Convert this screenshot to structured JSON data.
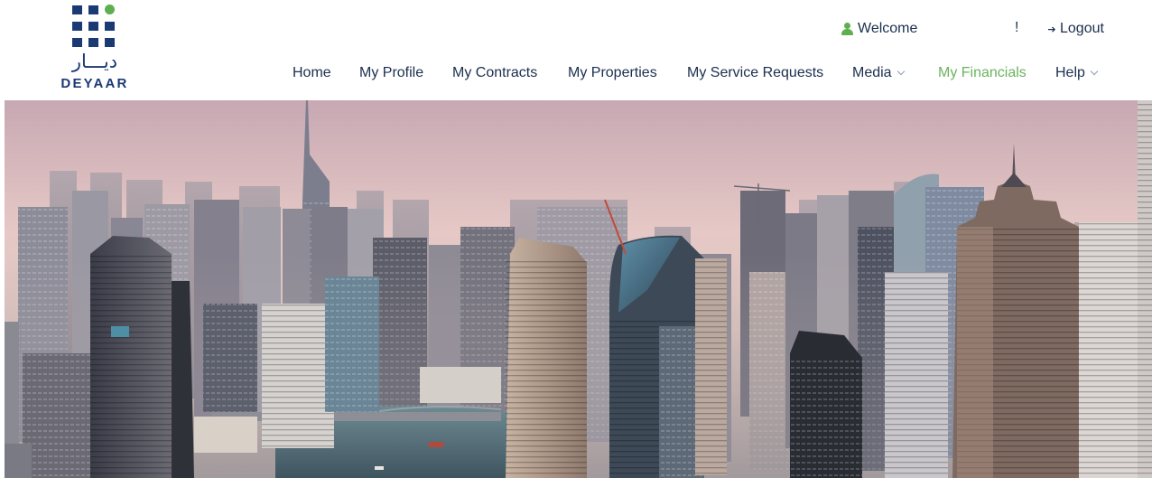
{
  "brand": {
    "logo_arabic": "ديـــار",
    "logo_word": "DEYAAR",
    "colors": {
      "navy": "#1b3a73",
      "green": "#5fae4f"
    }
  },
  "topbar": {
    "welcome_icon": "user-icon",
    "welcome_label": "Welcome",
    "alert_label": "!",
    "logout_icon": "sign-out-icon",
    "logout_label": "Logout"
  },
  "nav": {
    "items": [
      {
        "label": "Home"
      },
      {
        "label": "My Profile"
      },
      {
        "label": "My Contracts"
      },
      {
        "label": "My Properties"
      },
      {
        "label": "My Service Requests"
      },
      {
        "label": "Media",
        "dropdown": true
      },
      {
        "label": "My Financials",
        "active": true
      },
      {
        "label": "Help",
        "dropdown": true
      }
    ],
    "active_color": "#6bb35d"
  },
  "hero": {
    "image": "city skyline with skyscrapers and marina at dusk"
  }
}
